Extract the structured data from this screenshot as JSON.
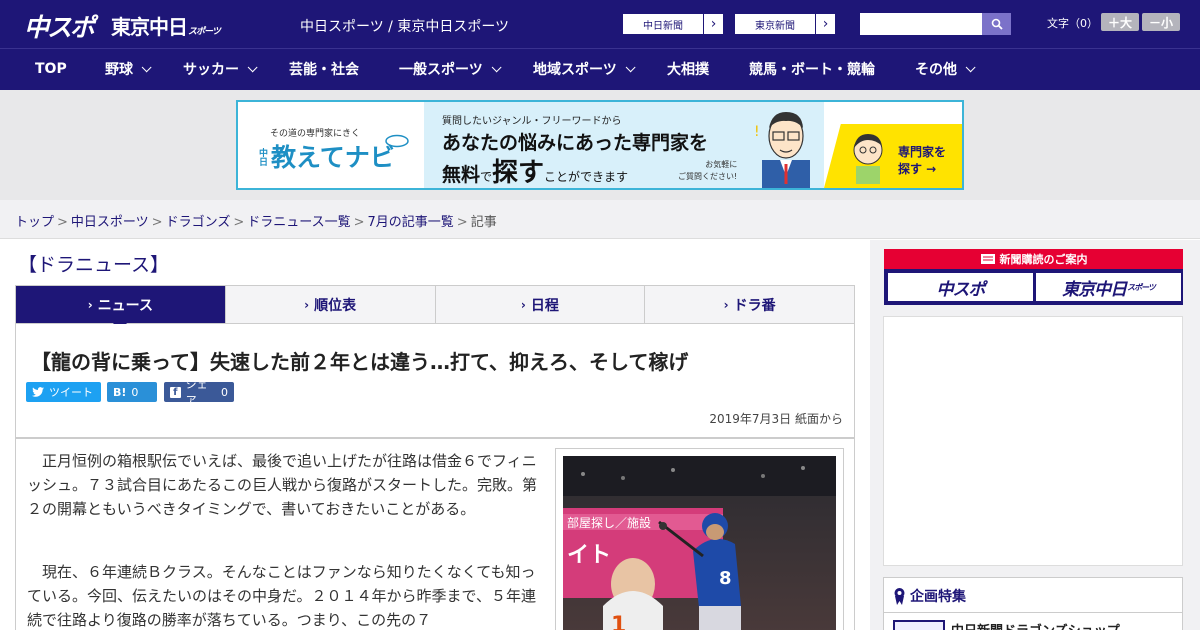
{
  "header": {
    "logo_chunichi": "中スポ",
    "logo_tokyo": "東京中日",
    "logo_tokyo_suffix": "スポーツ",
    "site_name": "中日スポーツ / 東京中日スポーツ",
    "paper_buttons": [
      "中日新聞",
      "東京新聞"
    ],
    "search_placeholder": "",
    "font_size_label": "文字（0）",
    "font_bigger": "＋大",
    "font_smaller": "－小"
  },
  "nav": [
    {
      "label": "TOP",
      "has_menu": false
    },
    {
      "label": "野球",
      "has_menu": true
    },
    {
      "label": "サッカー",
      "has_menu": true
    },
    {
      "label": "芸能・社会",
      "has_menu": false
    },
    {
      "label": "一般スポーツ",
      "has_menu": true
    },
    {
      "label": "地域スポーツ",
      "has_menu": true
    },
    {
      "label": "大相撲",
      "has_menu": false
    },
    {
      "label": "競馬・ボート・競輪",
      "has_menu": false
    },
    {
      "label": "その他",
      "has_menu": true
    }
  ],
  "ad_banner": {
    "sub_text": "その道の専門家にきく",
    "brand_prefix": "中日",
    "brand": "教えてナビ",
    "line1": "質問したいジャンル・フリーワードから",
    "line2": "あなたの悩みにあった専門家を",
    "line3_a": "無料",
    "line3_b": "で",
    "line3_c": "探す",
    "line3_d": "ことができます",
    "note_1": "お気軽に",
    "note_2": "ご質問ください!",
    "cta_1": "専門家を",
    "cta_2": "探す →"
  },
  "breadcrumb": {
    "items": [
      "トップ",
      "中日スポーツ",
      "ドラゴンズ",
      "ドラニュース一覧",
      "7月の記事一覧"
    ],
    "current": "記事",
    "separator": ">"
  },
  "section_title": "【ドラニュース】",
  "tabs": [
    {
      "label": "ニュース",
      "active": true
    },
    {
      "label": "順位表",
      "active": false
    },
    {
      "label": "日程",
      "active": false
    },
    {
      "label": "ドラ番",
      "active": false
    }
  ],
  "article": {
    "headline": "【龍の背に乗って】失速した前２年とは違う…打て、抑えろ、そして稼げ",
    "share": {
      "tweet_label": "ツイート",
      "hatena_label": "B!",
      "hatena_count": "0",
      "facebook_label": "シェア",
      "facebook_count": "0"
    },
    "date": "2019年7月3日 紙面から",
    "para1": "　正月恒例の箱根駅伝でいえば、最後で追い上げたが往路は借金６でフィニッシュ。７３試合目にあたるこの巨人戦から復路がスタートした。完敗。第２の開幕ともいうべきタイミングで、書いておきたいことがある。",
    "para2": "　現在、６年連続Ｂクラス。そんなことはファンなら知りたくなくても知っている。今回、伝えたいのはその中身だ。２０１４年から昨季まで、５年連続で往路より復路の勝率が落ちている。つまり、この先の７"
  },
  "sidebar": {
    "subscribe_head": "新聞購読のご案内",
    "subscribe_buttons": [
      "中スポ",
      "東京中日"
    ],
    "subscribe_suffix": "スポーツ",
    "kikaku_title": "企画特集",
    "kikaku_item": "中日新聞ドラゴンズショップ"
  },
  "colors": {
    "brand_navy": "#1e1677",
    "accent_red": "#e60033",
    "ad_border": "#3cb4d8",
    "ad_yellow": "#ffe300"
  }
}
